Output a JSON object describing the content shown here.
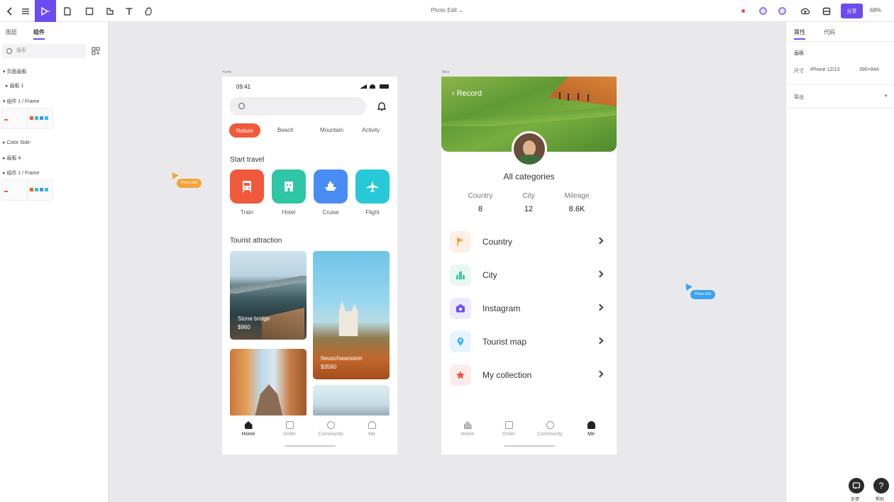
{
  "toolbar": {
    "doc_title": "Photo Edit ⌄",
    "primary_button": "分享",
    "zoom": "68%"
  },
  "left_panel": {
    "tabs": [
      "图层",
      "组件"
    ],
    "search_placeholder": "搜索",
    "tree": [
      "▾ 页面画板",
      "▸ 画板 1",
      "▾ 组件 1 / Frame",
      "▸ Color Side",
      "▸ 画板 4",
      "▸ 组件 1 / Frame"
    ]
  },
  "right_panel": {
    "tabs": [
      "属性",
      "代码"
    ],
    "heading": "画板",
    "row1_a": "尺寸",
    "row1_b": "iPhone 12/13",
    "row1_c": "390×844",
    "row2": "导出"
  },
  "bottom_right": {
    "chat_label": "反馈",
    "help_label": "帮助"
  },
  "cursors": {
    "orange_tag": "Photo Edit",
    "blue_tag": "Photo Edit"
  },
  "frame_labels": {
    "frame1": "Home",
    "frame2": "Mine"
  },
  "phone1": {
    "time": "09:41",
    "chips": [
      "Nature",
      "Beach",
      "Mountain",
      "Activity"
    ],
    "start_travel": "Start travel",
    "travel_tiles": [
      "Train",
      "Hotel",
      "Cruise",
      "Flight"
    ],
    "tourist_attraction": "Tourist attraction",
    "photo1_caption1": "Stone bridge",
    "photo1_caption2": "$960",
    "photo2_caption1": "Neuschwanstein",
    "photo2_caption2": "$3560",
    "nav": [
      "Home",
      "Order",
      "Community",
      "Me"
    ]
  },
  "phone2": {
    "back": "Record",
    "all_categories": "All categories",
    "stats": [
      {
        "label": "Country",
        "value": "8"
      },
      {
        "label": "City",
        "value": "12"
      },
      {
        "label": "Mileage",
        "value": "8.6K"
      }
    ],
    "menu": [
      "Country",
      "City",
      "Instagram",
      "Tourist map",
      "My collection"
    ],
    "nav": [
      "Home",
      "Order",
      "Community",
      "Me"
    ]
  },
  "colors": {
    "accent": "#6c4cf0",
    "orange": "#f0593c",
    "teal": "#2ec6a5",
    "blue": "#4a8cf6",
    "cyan": "#27c8d8"
  }
}
